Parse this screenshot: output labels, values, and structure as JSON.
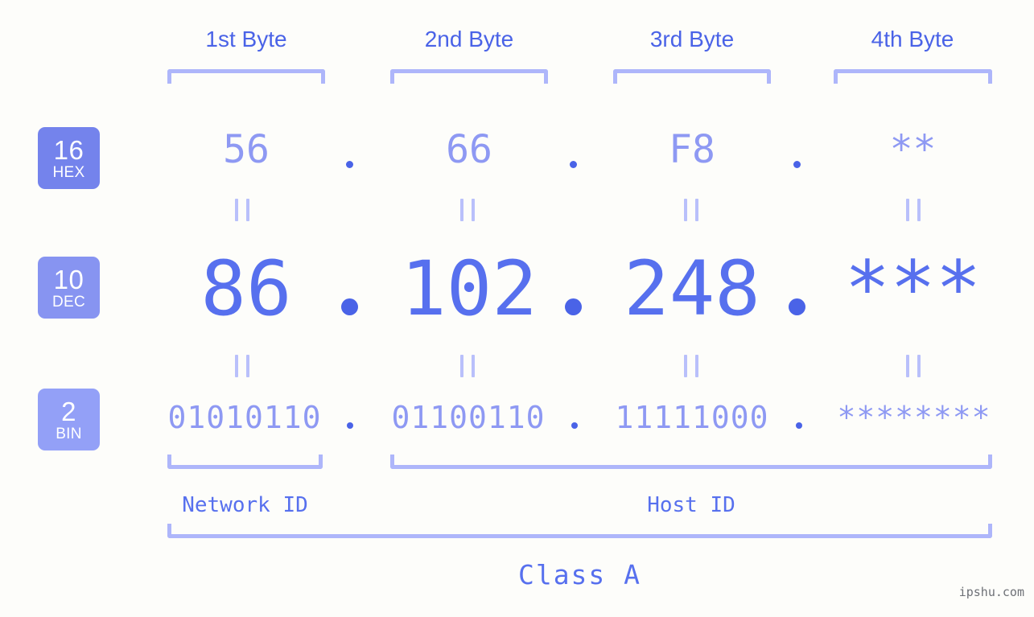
{
  "background_color": "#fdfdfa",
  "accent_colors": {
    "header_text": "#4a63e7",
    "bracket": "#aeb6fa",
    "hex_value": "#8e99f3",
    "dec_value": "#5770ee",
    "bin_value": "#8e99f3",
    "badge_hex": "#7483ec",
    "badge_dec": "#8794f1",
    "badge_bin": "#93a0f7",
    "equals_mark": "#b9c0fb",
    "watermark": "#55585f"
  },
  "byte_headers": [
    {
      "label": "1st Byte"
    },
    {
      "label": "2nd Byte"
    },
    {
      "label": "3rd Byte"
    },
    {
      "label": "4th Byte"
    }
  ],
  "bases": [
    {
      "number": "16",
      "name": "HEX"
    },
    {
      "number": "10",
      "name": "DEC"
    },
    {
      "number": "2",
      "name": "BIN"
    }
  ],
  "rows": {
    "hex": {
      "values": [
        "56",
        "66",
        "F8",
        "**"
      ],
      "separator": "."
    },
    "dec": {
      "values": [
        "86",
        "102",
        "248",
        "***"
      ],
      "separator": "."
    },
    "bin": {
      "values": [
        "01010110",
        "01100110",
        "11111000",
        "********"
      ],
      "separator": "."
    }
  },
  "segments": {
    "network_id": "Network ID",
    "host_id": "Host ID"
  },
  "class_label": "Class A",
  "watermark": "ipshu.com"
}
